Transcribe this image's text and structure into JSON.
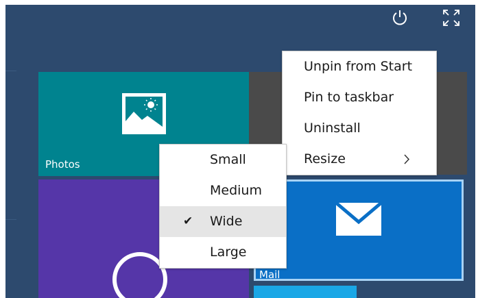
{
  "colors": {
    "background": "#2d4a6e",
    "photos_tile": "#00838f",
    "purple_tile": "#5536a8",
    "dark_tile": "#4a4a4a",
    "mail_tile": "#0a6fc6",
    "mail_focus_border": "#a8d2f4",
    "cyan_tile": "#1aa7e6",
    "menu_background": "#ffffff",
    "menu_selected": "#e5e5e5"
  },
  "top_bar": {
    "power_icon": "power-icon",
    "expand_icon": "expand-icon"
  },
  "tiles": {
    "photos": {
      "label": "Photos",
      "icon": "photos-icon"
    },
    "mail": {
      "label": "Mail",
      "icon": "mail-envelope-icon"
    }
  },
  "context_menu": {
    "items": [
      {
        "label": "Unpin from Start"
      },
      {
        "label": "Pin to taskbar"
      },
      {
        "label": "Uninstall"
      },
      {
        "label": "Resize",
        "icon": "chevron-right-icon"
      }
    ]
  },
  "resize_submenu": {
    "items": [
      {
        "label": "Small",
        "selected": false
      },
      {
        "label": "Medium",
        "selected": false
      },
      {
        "label": "Wide",
        "selected": true,
        "check": "✔"
      },
      {
        "label": "Large",
        "selected": false
      }
    ]
  }
}
